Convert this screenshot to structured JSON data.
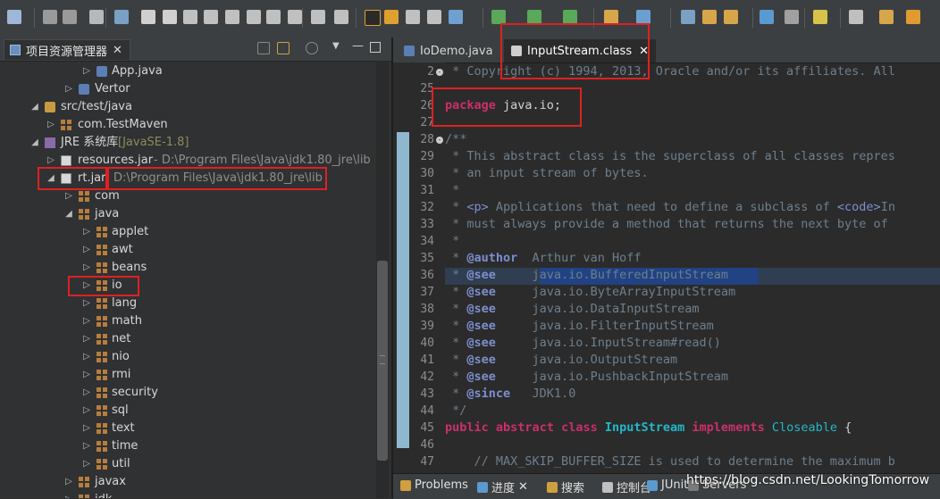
{
  "toolbar": {
    "icons": [
      "new-icon",
      "save-icon",
      "save-all-icon",
      "print-icon",
      "skip-breakpoints-icon",
      "resume-icon",
      "suspend-icon",
      "terminate-icon",
      "disconnect-icon",
      "step-into-icon",
      "step-over-icon",
      "step-return-icon",
      "drop-to-frame-icon",
      "use-step-filters-icon",
      "open-declaration-icon",
      "mark-occurrences-icon",
      "toggle-block-selection-icon",
      "show-whitespace-icon",
      "word-wrap-icon",
      "external-tools-icon",
      "debug-icon",
      "run-icon",
      "run-last-icon",
      "new-java-project-icon",
      "new-class-icon",
      "open-type-icon",
      "open-task-icon",
      "search-icon",
      "globe-icon",
      "tools-icon",
      "next-annotation-icon",
      "prev-annotation-icon",
      "last-edit-icon",
      "back-icon",
      "forward-icon"
    ]
  },
  "left_panel": {
    "tab_title": "项目资源管理器",
    "tree": [
      {
        "label": "App.java",
        "extra": "",
        "icon": "java-file-icon"
      },
      {
        "label": "Vertor",
        "extra": "",
        "icon": "java-file-icon"
      },
      {
        "label": "src/test/java",
        "extra": "",
        "icon": "source-folder-icon"
      },
      {
        "label": "com.TestMaven",
        "extra": "",
        "icon": "package-icon"
      },
      {
        "label": "JRE 系统库",
        "extra": "[JavaSE-1.8]",
        "icon": "library-icon"
      },
      {
        "label": "resources.jar",
        "extra": "- D:\\Program Files\\Java\\jdk1.80_jre\\lib",
        "icon": "jar-icon"
      },
      {
        "label": "rt.jar",
        "extra": "D:\\Program Files\\Java\\jdk1.80_jre\\lib",
        "icon": "jar-icon"
      },
      {
        "label": "com",
        "extra": "",
        "icon": "package-icon"
      },
      {
        "label": "java",
        "extra": "",
        "icon": "package-icon"
      },
      {
        "label": "applet",
        "extra": "",
        "icon": "package-icon"
      },
      {
        "label": "awt",
        "extra": "",
        "icon": "package-icon"
      },
      {
        "label": "beans",
        "extra": "",
        "icon": "package-icon"
      },
      {
        "label": "io",
        "extra": "",
        "icon": "package-icon"
      },
      {
        "label": "lang",
        "extra": "",
        "icon": "package-icon"
      },
      {
        "label": "math",
        "extra": "",
        "icon": "package-icon"
      },
      {
        "label": "net",
        "extra": "",
        "icon": "package-icon"
      },
      {
        "label": "nio",
        "extra": "",
        "icon": "package-icon"
      },
      {
        "label": "rmi",
        "extra": "",
        "icon": "package-icon"
      },
      {
        "label": "security",
        "extra": "",
        "icon": "package-icon"
      },
      {
        "label": "sql",
        "extra": "",
        "icon": "package-icon"
      },
      {
        "label": "text",
        "extra": "",
        "icon": "package-icon"
      },
      {
        "label": "time",
        "extra": "",
        "icon": "package-icon"
      },
      {
        "label": "util",
        "extra": "",
        "icon": "package-icon"
      },
      {
        "label": "javax",
        "extra": "",
        "icon": "package-icon"
      },
      {
        "label": "jdk",
        "extra": "",
        "icon": "package-icon"
      }
    ]
  },
  "editor": {
    "tabs": [
      {
        "label": "IoDemo.java",
        "active": false
      },
      {
        "label": "InputStream.class",
        "active": true
      }
    ],
    "lines": [
      {
        "n": "2",
        "text": " * Copyright (c) 1994, 2013, Oracle and/or its affiliates. All"
      },
      {
        "n": "25",
        "text": ""
      },
      {
        "n": "26",
        "text": "package java.io;"
      },
      {
        "n": "27",
        "text": ""
      },
      {
        "n": "28",
        "text": "/**"
      },
      {
        "n": "29",
        "text": " * This abstract class is the superclass of all classes repres"
      },
      {
        "n": "30",
        "text": " * an input stream of bytes."
      },
      {
        "n": "31",
        "text": " *"
      },
      {
        "n": "32",
        "text": " * <p> Applications that need to define a subclass of <code>In"
      },
      {
        "n": "33",
        "text": " * must always provide a method that returns the next byte of"
      },
      {
        "n": "34",
        "text": " *"
      },
      {
        "n": "35",
        "text": " * @author  Arthur van Hoff"
      },
      {
        "n": "36",
        "text": " * @see     java.io.BufferedInputStream"
      },
      {
        "n": "37",
        "text": " * @see     java.io.ByteArrayInputStream"
      },
      {
        "n": "38",
        "text": " * @see     java.io.DataInputStream"
      },
      {
        "n": "39",
        "text": " * @see     java.io.FilterInputStream"
      },
      {
        "n": "40",
        "text": " * @see     java.io.InputStream#read()"
      },
      {
        "n": "41",
        "text": " * @see     java.io.OutputStream"
      },
      {
        "n": "42",
        "text": " * @see     java.io.PushbackInputStream"
      },
      {
        "n": "43",
        "text": " * @since   JDK1.0"
      },
      {
        "n": "44",
        "text": " */"
      },
      {
        "n": "45",
        "text": "public abstract class InputStream implements Closeable {"
      },
      {
        "n": "46",
        "text": ""
      },
      {
        "n": "47",
        "text": "    // MAX_SKIP_BUFFER_SIZE is used to determine the maximum b"
      }
    ]
  },
  "bottom_panel": {
    "tabs": [
      "Problems",
      "进度",
      "搜索",
      "控制台",
      "JUnit",
      "Servers"
    ]
  },
  "watermark": "https://blog.csdn.net/LookingTomorrow",
  "colors": {
    "highlight_box": "#e02020",
    "keyword": "#cc2f6a",
    "type": "#21b8c9",
    "comment": "#6e7f8d"
  }
}
